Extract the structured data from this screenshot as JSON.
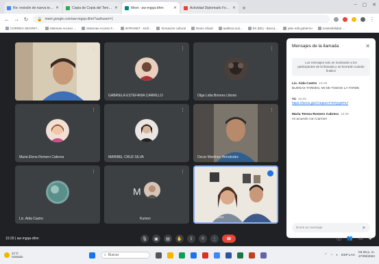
{
  "browser": {
    "tabs": [
      {
        "title": "Re: revisión de nueva tema para ...",
        "fav": "#4285f4",
        "active": false
      },
      {
        "title": "Copia de Copia del Tema en cur...",
        "fav": "#34a853",
        "active": false
      },
      {
        "title": "Meet - aw-mgqa-dhm",
        "fav": "#00897b",
        "active": true
      },
      {
        "title": "Actividad Diplomado Fortalecimie...",
        "fav": "#ea4335",
        "active": false
      }
    ],
    "url": "meet.google.com/aw-mgqa-dhm?authuser=1",
    "bookmarks": [
      "CORREO SECRET...",
      "sistemas Acceso ...",
      "Sistemas Acceso F...",
      "INTRANET - Dell...",
      "formación cultural",
      "Diario oficial",
      "auditora suir...",
      "En (DE) - Busca...",
      "plan edit gobierno",
      "sostenibilidad ..."
    ]
  },
  "meet": {
    "participants": [
      {
        "name": "",
        "kind": "video1"
      },
      {
        "name": "GABRIELA ESTEFANIA CARRILLO",
        "kind": "avatar",
        "color": "#e8cfc0"
      },
      {
        "name": "Olga Lidia Briones Liborio",
        "kind": "avatar",
        "color": "#4a3f3a"
      },
      {
        "name": "Maria Elena Romero Cabrera",
        "kind": "avatar",
        "color": "#f2dfd5"
      },
      {
        "name": "MARIBEL CRUZ SILVA",
        "kind": "avatar",
        "color": "#e9e6e3"
      },
      {
        "name": "Oscar Martínez Hernández",
        "kind": "video2"
      },
      {
        "name": "Lic. Aida Castro",
        "kind": "avatar",
        "color": "#7aa6a6"
      },
      {
        "name": "Kumen",
        "kind": "avatar-m",
        "letter": "M",
        "color": "#d9c4b8"
      },
      {
        "name": "Lucía Rodríguez",
        "kind": "video3"
      }
    ],
    "meeting_info": "15:29  |  aw-mgqa-dhm",
    "chat": {
      "title": "Mensajes de la llamada",
      "notice": "Los mensajes solo se mostrarán a los participantes de la llamada y se borrarán cuando finalice",
      "messages": [
        {
          "sender": "Lic. Aida Castro",
          "time": "15:26",
          "text": "BUENAS TARDES, MI DE TODOS LA TARDE",
          "link": false
        },
        {
          "sender": "Tú",
          "time": "15:26",
          "text": "https://forms.gle/iY3q6aYF7kPyQ6Po7",
          "link": true
        },
        {
          "sender": "Maria Teresa Romero Cabrera",
          "time": "15:26",
          "text": "mi acuerdo con Carmen",
          "link": false
        }
      ],
      "input_placeholder": "Envía un mensaje"
    }
  },
  "taskbar": {
    "weather_temp": "21°C",
    "weather_desc": "Soleado",
    "search": "Buscar",
    "time": "03:35 p. m.",
    "date": "27/09/2022",
    "lang": "ESP LAA"
  }
}
